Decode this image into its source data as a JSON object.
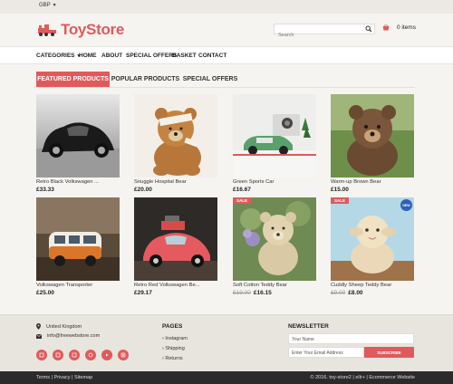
{
  "topbar": {
    "currency": "GBP"
  },
  "header": {
    "logo_text": "ToyStore",
    "search_placeholder": "Search",
    "cart_text": "0 items"
  },
  "nav": {
    "categories": "CATEGORIES",
    "home": "HOME",
    "about": "ABOUT",
    "special_offers": "SPECIAL OFFERS",
    "basket": "BASKET",
    "contact": "CONTACT"
  },
  "tabs": {
    "featured": "FEATURED PRODUCTS",
    "popular": "POPULAR PRODUCTS",
    "special": "SPECIAL OFFERS"
  },
  "products": [
    {
      "name": "Retro Black Volkswagen ...",
      "price": "£33.33",
      "old_price": ""
    },
    {
      "name": "Snuggle Hospital Bear",
      "price": "£20.00",
      "old_price": ""
    },
    {
      "name": "Green Sports Car",
      "price": "£16.67",
      "old_price": ""
    },
    {
      "name": "Warm-up Brown Bear",
      "price": "£15.00",
      "old_price": ""
    },
    {
      "name": "Volkswagen Transporter",
      "price": "£25.00",
      "old_price": ""
    },
    {
      "name": "Retro Red Volkswagen Be...",
      "price": "£29.17",
      "old_price": ""
    },
    {
      "name": "Soft Cotton Teddy Bear",
      "price": "£16.15",
      "old_price": "£19.00",
      "badge": "SALE"
    },
    {
      "name": "Cuddly Sheep Teddy Bear",
      "price": "£8.00",
      "old_price": "£9.00",
      "badge": "SALE",
      "badge2": "NEW"
    }
  ],
  "footer": {
    "location": "United Kingdom",
    "email": "info@freewebstore.com",
    "pages_heading": "PAGES",
    "pages": [
      "Instagram",
      "Shipping",
      "Returns"
    ],
    "newsletter_heading": "NEWSLETTER",
    "name_placeholder": "Your Name",
    "email_placeholder": "Enter Your Email Address",
    "subscribe": "SUBSCRIBE"
  },
  "bottom": {
    "links": "Terms | Privacy | Sitemap",
    "copyright": "© 2016. toy-store2 | ellr+ | Ecommerce Website"
  },
  "colors": {
    "accent": "#e05a5c",
    "footer_bg": "#e8e4de",
    "bottom_bg": "#2b2b2b"
  }
}
